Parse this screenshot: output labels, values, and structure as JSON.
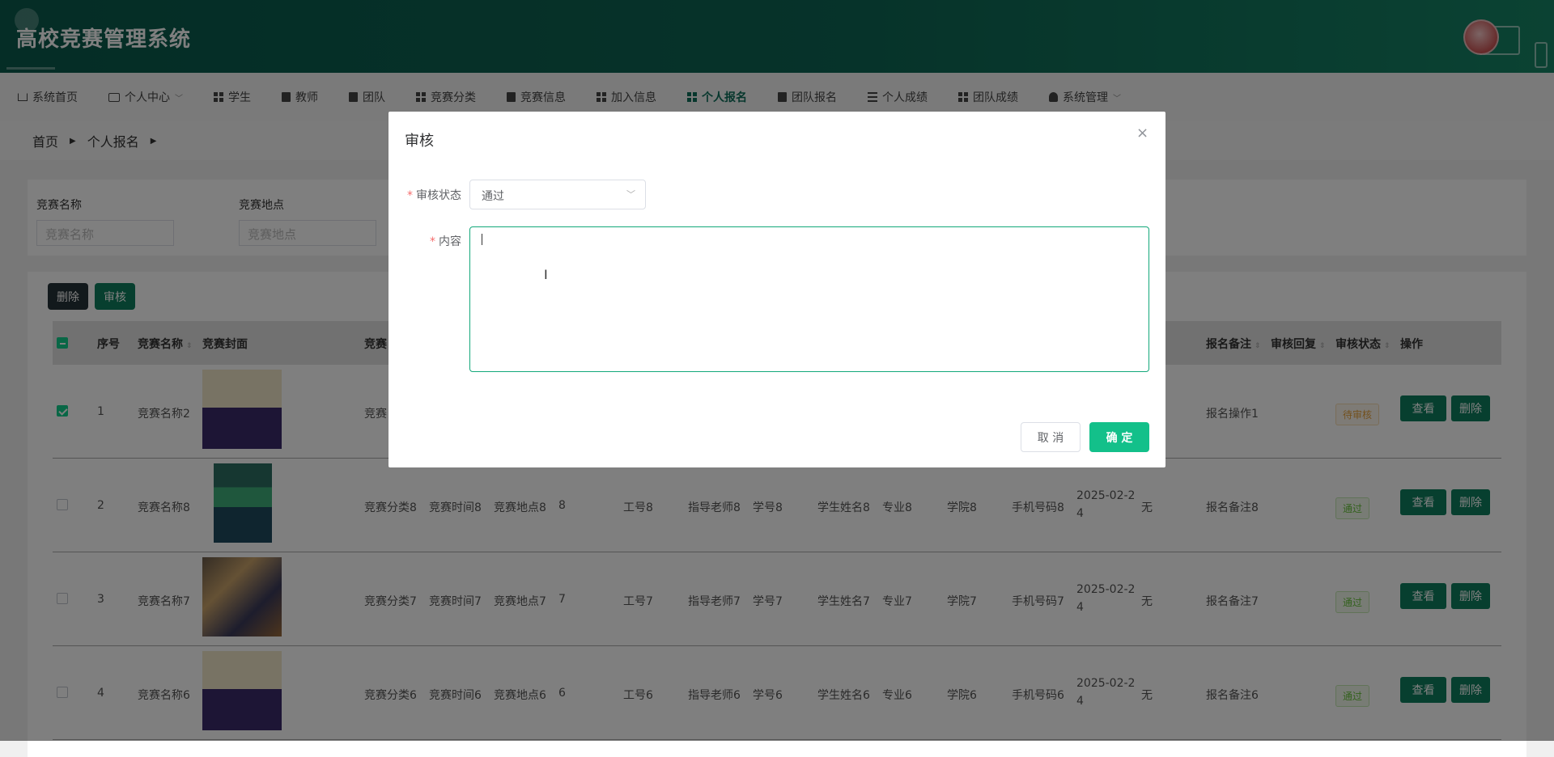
{
  "app": {
    "title": "高校竞赛管理系统"
  },
  "nav": {
    "items": [
      {
        "label": "系统首页",
        "icon": "home-icon"
      },
      {
        "label": "个人中心",
        "icon": "box-icon",
        "dropdown": true
      },
      {
        "label": "学生",
        "icon": "grid-icon"
      },
      {
        "label": "教师",
        "icon": "briefcase-icon"
      },
      {
        "label": "团队",
        "icon": "book-icon"
      },
      {
        "label": "竞赛分类",
        "icon": "grid-icon"
      },
      {
        "label": "竞赛信息",
        "icon": "book-icon"
      },
      {
        "label": "加入信息",
        "icon": "grid-icon"
      },
      {
        "label": "个人报名",
        "icon": "grid-icon",
        "active": true
      },
      {
        "label": "团队报名",
        "icon": "clipboard-icon"
      },
      {
        "label": "个人成绩",
        "icon": "list-icon"
      },
      {
        "label": "团队成绩",
        "icon": "grid-icon"
      },
      {
        "label": "系统管理",
        "icon": "user-icon",
        "dropdown": true
      }
    ]
  },
  "breadcrumb": {
    "home": "首页",
    "current": "个人报名"
  },
  "search": {
    "fields": [
      {
        "label": "竞赛名称",
        "placeholder": "竞赛名称"
      },
      {
        "label": "竞赛地点",
        "placeholder": "竞赛地点"
      }
    ]
  },
  "toolbar": {
    "delete_label": "删除",
    "review_label": "审核"
  },
  "table": {
    "headers": {
      "index": "序号",
      "name": "竞赛名称",
      "cover": "竞赛封面",
      "partial": "竞赛",
      "remark": "报名备注",
      "reply": "审核回复",
      "status": "审核状态",
      "action": "操作"
    },
    "rows": [
      {
        "index": "1",
        "name": "竞赛名称2",
        "checked": true,
        "category": "竞赛",
        "time": "",
        "place": "",
        "num": "",
        "work_no": "",
        "teacher": "",
        "student_no": "",
        "student_name": "",
        "major": "",
        "college": "",
        "phone": "",
        "date1": "",
        "date2": "",
        "reply_val": "",
        "remark": "报名操作1",
        "status": "待审核",
        "status_type": "pending"
      },
      {
        "index": "2",
        "name": "竞赛名称8",
        "checked": false,
        "category": "竞赛分类8",
        "time": "竞赛时间8",
        "place": "竞赛地点8",
        "num": "8",
        "work_no": "工号8",
        "teacher": "指导老师8",
        "student_no": "学号8",
        "student_name": "学生姓名8",
        "major": "专业8",
        "college": "学院8",
        "phone": "手机号码8",
        "date1": "2025-02-2",
        "date2": "4",
        "reply_val": "无",
        "remark": "报名备注8",
        "status": "通过",
        "status_type": "ok"
      },
      {
        "index": "3",
        "name": "竞赛名称7",
        "checked": false,
        "category": "竞赛分类7",
        "time": "竞赛时间7",
        "place": "竞赛地点7",
        "num": "7",
        "work_no": "工号7",
        "teacher": "指导老师7",
        "student_no": "学号7",
        "student_name": "学生姓名7",
        "major": "专业7",
        "college": "学院7",
        "phone": "手机号码7",
        "date1": "2025-02-2",
        "date2": "4",
        "reply_val": "无",
        "remark": "报名备注7",
        "status": "通过",
        "status_type": "ok"
      },
      {
        "index": "4",
        "name": "竞赛名称6",
        "checked": false,
        "category": "竞赛分类6",
        "time": "竞赛时间6",
        "place": "竞赛地点6",
        "num": "6",
        "work_no": "工号6",
        "teacher": "指导老师6",
        "student_no": "学号6",
        "student_name": "学生姓名6",
        "major": "专业6",
        "college": "学院6",
        "phone": "手机号码6",
        "date1": "2025-02-2",
        "date2": "4",
        "reply_val": "无",
        "remark": "报名备注6",
        "status": "通过",
        "status_type": "ok"
      }
    ],
    "actions": {
      "view": "查看",
      "delete": "删除"
    }
  },
  "dialog": {
    "title": "审核",
    "status_label": "审核状态",
    "status_value": "通过",
    "content_label": "内容",
    "content_value": "",
    "cancel_label": "取 消",
    "confirm_label": "确 定",
    "close_glyph": "×"
  },
  "colors": {
    "accent": "#13c08a",
    "header": "#0d6654",
    "button": "#0f7f5e",
    "pending": "#e6a23c",
    "ok": "#67c23a"
  }
}
